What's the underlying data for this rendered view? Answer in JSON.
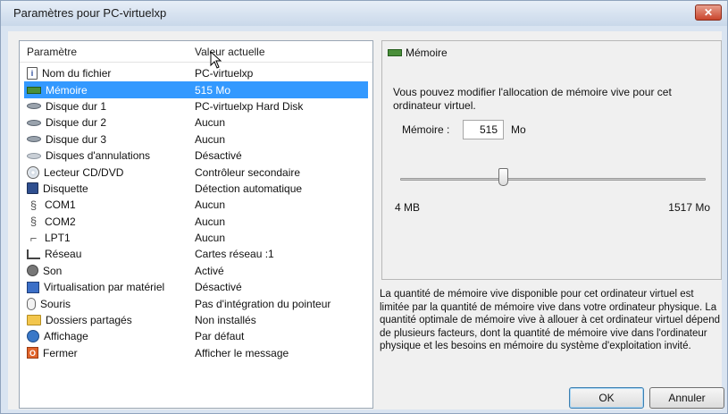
{
  "window": {
    "title": "Paramètres pour PC-virtuelxp"
  },
  "list": {
    "headers": {
      "param": "Paramètre",
      "value": "Valeur actuelle"
    },
    "items": [
      {
        "name": "Nom du fichier",
        "value": "PC-virtuelxp",
        "icon": "file-icon"
      },
      {
        "name": "Mémoire",
        "value": "515 Mo",
        "icon": "memory-icon",
        "selected": true
      },
      {
        "name": "Disque dur 1",
        "value": "PC-virtuelxp Hard Disk",
        "icon": "hard-disk-icon"
      },
      {
        "name": "Disque dur 2",
        "value": "Aucun",
        "icon": "hard-disk-icon"
      },
      {
        "name": "Disque dur 3",
        "value": "Aucun",
        "icon": "hard-disk-icon"
      },
      {
        "name": "Disques d'annulations",
        "value": "Désactivé",
        "icon": "undo-disk-icon"
      },
      {
        "name": "Lecteur CD/DVD",
        "value": "Contrôleur secondaire",
        "icon": "cd-dvd-icon"
      },
      {
        "name": "Disquette",
        "value": "Détection automatique",
        "icon": "floppy-icon"
      },
      {
        "name": "COM1",
        "value": "Aucun",
        "icon": "com-port-icon"
      },
      {
        "name": "COM2",
        "value": "Aucun",
        "icon": "com-port-icon"
      },
      {
        "name": "LPT1",
        "value": "Aucun",
        "icon": "lpt-port-icon"
      },
      {
        "name": "Réseau",
        "value": "Cartes réseau :1",
        "icon": "network-icon"
      },
      {
        "name": "Son",
        "value": "Activé",
        "icon": "sound-icon"
      },
      {
        "name": "Virtualisation par matériel",
        "value": "Désactivé",
        "icon": "hardware-virtualization-icon"
      },
      {
        "name": "Souris",
        "value": "Pas d'intégration du pointeur",
        "icon": "mouse-icon"
      },
      {
        "name": "Dossiers partagés",
        "value": "Non installés",
        "icon": "shared-folder-icon"
      },
      {
        "name": "Affichage",
        "value": "Par défaut",
        "icon": "display-icon"
      },
      {
        "name": "Fermer",
        "value": "Afficher le message",
        "icon": "close-action-icon"
      }
    ]
  },
  "memory_panel": {
    "title": "Mémoire",
    "description": "Vous pouvez modifier l'allocation de mémoire vive pour cet ordinateur virtuel.",
    "label": "Mémoire :",
    "value": "515",
    "unit": "Mo",
    "slider": {
      "min_label": "4 MB",
      "max_label": "1517 Mo",
      "min": 4,
      "max": 1517,
      "current": 515
    }
  },
  "info_text": "La quantité de mémoire vive disponible pour cet ordinateur virtuel est limitée par la quantité de mémoire vive dans votre ordinateur physique. La quantité optimale de mémoire vive à allouer à cet ordinateur virtuel dépend de plusieurs facteurs, dont la quantité de mémoire vive dans l'ordinateur physique et les besoins en mémoire du système d'exploitation invité.",
  "buttons": {
    "ok": "OK",
    "cancel": "Annuler"
  }
}
